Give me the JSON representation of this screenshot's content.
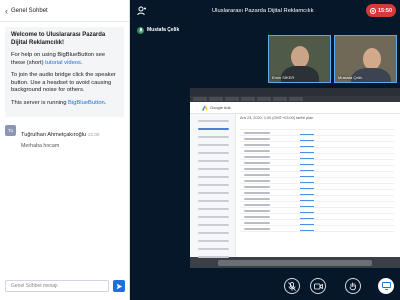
{
  "chat": {
    "header_title": "Genel Sohbet",
    "welcome_title": "Welcome to Uluslararası Pazarda Dijital Reklamcılık!",
    "help_prefix": "For help on using BigBlueButton see these (short) ",
    "help_link": "tutorial videos",
    "help_suffix": ".",
    "audio_text": "To join the audio bridge click the speaker button. Use a headset to avoid causing background noise for others.",
    "running_prefix": "This server is running ",
    "running_link": "BigBlueButton",
    "running_suffix": ".",
    "message": {
      "avatar": "Tu",
      "sender": "Tuğrulhan Ahmetçakıroğlu",
      "time": "21:00",
      "text": "Merhaba hocam"
    },
    "input_placeholder": "Genel Sohbet mesajı"
  },
  "topbar": {
    "meeting_title": "Uluslararası Pazarda Dijital Reklamcılık",
    "record_time": "15:50"
  },
  "presenter": {
    "name": "Mustafa Çelik"
  },
  "webcams": [
    {
      "name": "Emin SİKER"
    },
    {
      "name": "Mustafa Çelik"
    }
  ],
  "shared_screen": {
    "app_name": "Google Ads",
    "date_range": "Ara 23, 2020, 1:00 (GMT+03:00) tarihli plan"
  },
  "colors": {
    "app_bg": "#06172A",
    "accent": "#1e6fd9",
    "record": "#D33B3B",
    "webcam_border": "#5aa8f0"
  }
}
